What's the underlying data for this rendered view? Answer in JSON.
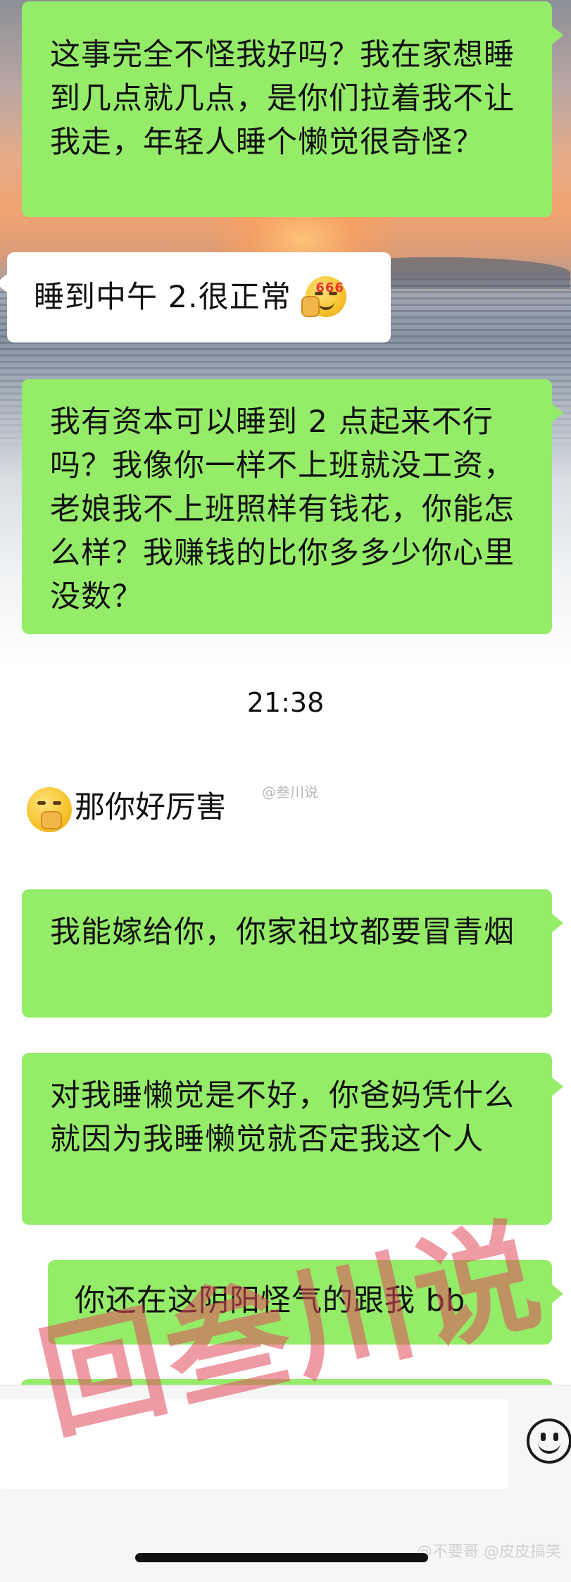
{
  "messages": {
    "m1": "这事完全不怪我好吗？我在家想睡到几点就几点，是你们拉着我不让我走，年轻人睡个懒觉很奇怪？",
    "m2": "睡到中午 2.很正常",
    "m3": "我有资本可以睡到 2 点起来不行吗？我像你一样不上班就没工资，老娘我不上班照样有钱花，你能怎么样？我赚钱的比你多多少你心里没数？",
    "m4": "那你好厉害",
    "m5": "我能嫁给你，你家祖坟都要冒青烟",
    "m6": "对我睡懒觉是不好，你爸妈凭什么就因为我睡懒觉就否定我这个人",
    "m7": "你还在这阴阳怪气的跟我 bb"
  },
  "timestamp": "21:38",
  "emoji": {
    "m2_sticker": "smug-666-emoji",
    "m2_badge": "666",
    "m4_sticker": "covering-mouth-emoji"
  },
  "watermark": {
    "text": "回叁川说",
    "inline": "@叁川说",
    "bottom": "@不要哥 @皮皮搞笑"
  },
  "colors": {
    "my_bubble": "#95ec69",
    "their_bubble": "#ffffff",
    "watermark": "#e2485c"
  },
  "icons": {
    "input_emoji": "smiley-face-icon"
  }
}
